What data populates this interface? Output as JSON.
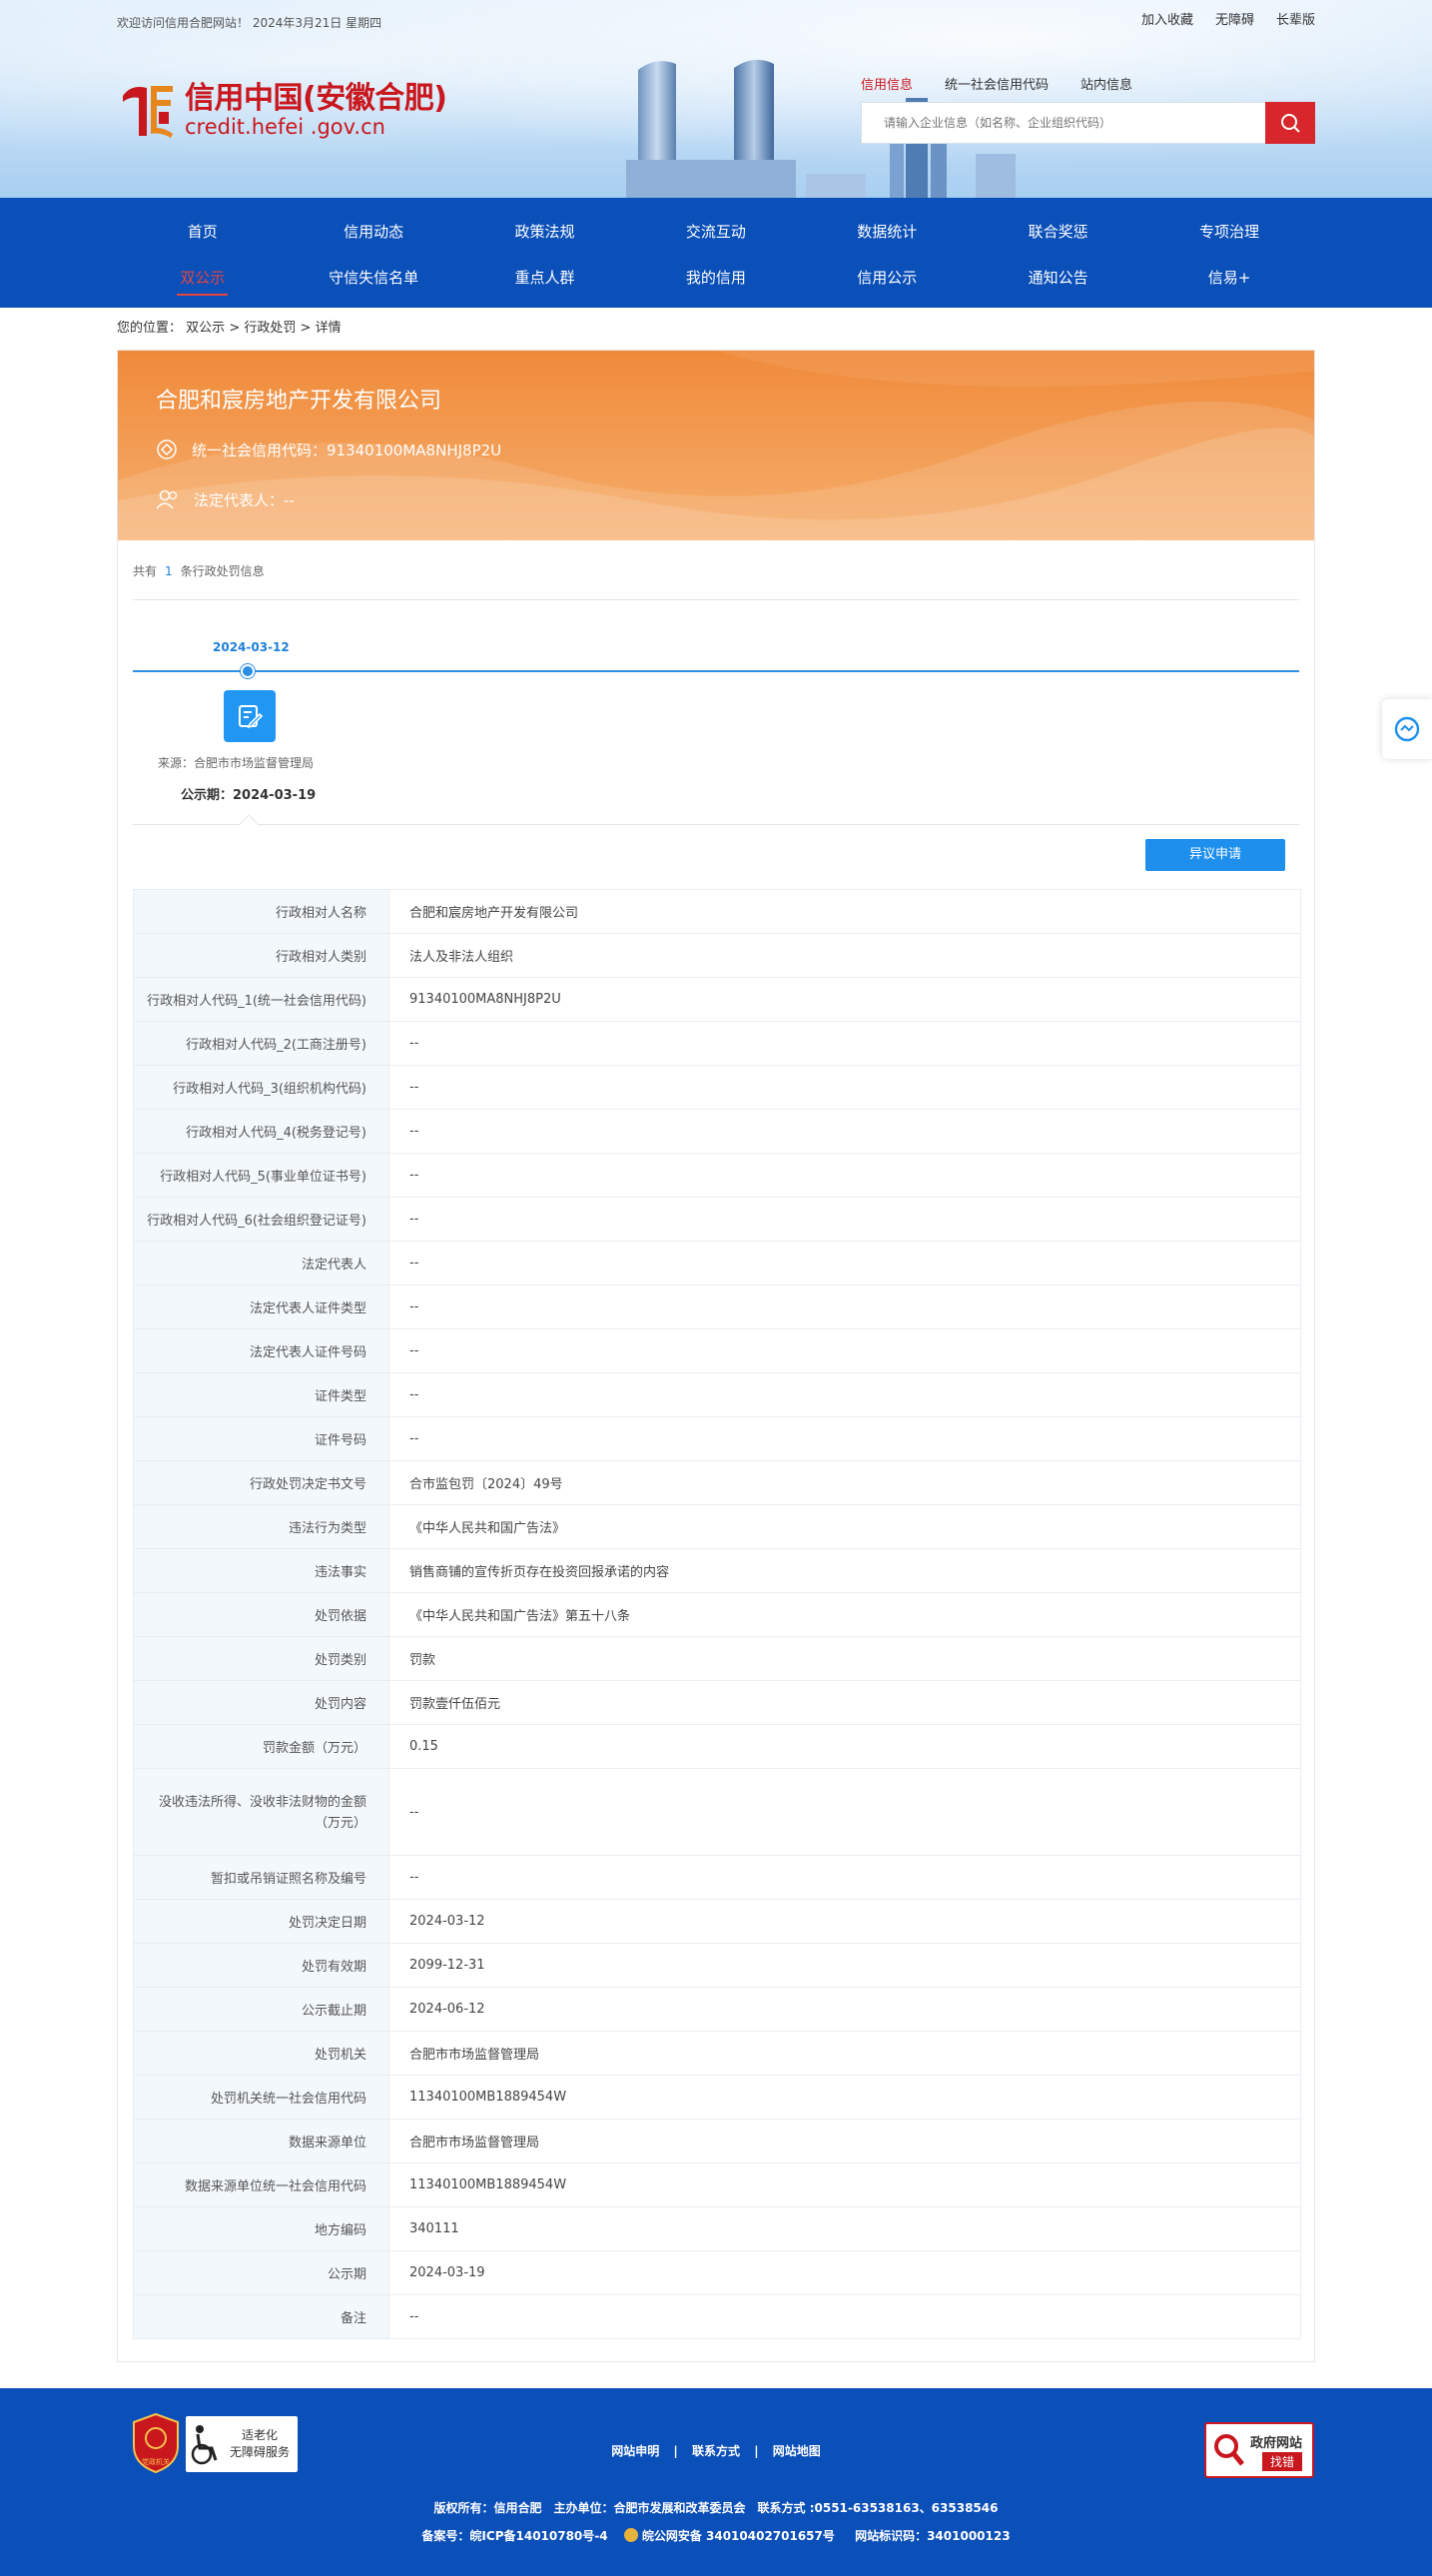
{
  "topbar": {
    "welcome": "欢迎访问信用合肥网站！ 2024年3月21日 星期四",
    "links": [
      "加入收藏",
      "无障碍",
      "长辈版"
    ]
  },
  "logo": {
    "cn": "信用中国(安徽合肥)",
    "en": "credit.hefei .gov.cn"
  },
  "search": {
    "tabs": [
      "信用信息",
      "统一社会信用代码",
      "站内信息"
    ],
    "placeholder": "请输入企业信息（如名称、企业组织代码）"
  },
  "nav": {
    "row1": [
      "首页",
      "信用动态",
      "政策法规",
      "交流互动",
      "数据统计",
      "联合奖惩",
      "专项治理"
    ],
    "row2": [
      "双公示",
      "守信失信名单",
      "重点人群",
      "我的信用",
      "信用公示",
      "通知公告",
      "信易+"
    ]
  },
  "breadcrumb": {
    "label": "您的位置：",
    "items": [
      "双公示",
      "行政处罚",
      "详情"
    ],
    "sep": ">"
  },
  "company": {
    "name": "合肥和宸房地产开发有限公司",
    "credit_code": "统一社会信用代码：91340100MA8NHJ8P2U",
    "legal_rep": "法定代表人：--"
  },
  "count": {
    "prefix": "共有",
    "value": "1",
    "suffix": "条行政处罚信息"
  },
  "timeline": {
    "date": "2024-03-12",
    "source": "来源：合肥市市场监督管理局",
    "public_period": "公示期：2024-03-19"
  },
  "objection_button": "异议申请",
  "details": [
    {
      "k": "行政相对人名称",
      "v": "合肥和宸房地产开发有限公司"
    },
    {
      "k": "行政相对人类别",
      "v": "法人及非法人组织"
    },
    {
      "k": "行政相对人代码_1(统一社会信用代码)",
      "v": "91340100MA8NHJ8P2U"
    },
    {
      "k": "行政相对人代码_2(工商注册号)",
      "v": "--"
    },
    {
      "k": "行政相对人代码_3(组织机构代码)",
      "v": "--"
    },
    {
      "k": "行政相对人代码_4(税务登记号)",
      "v": "--"
    },
    {
      "k": "行政相对人代码_5(事业单位证书号)",
      "v": "--"
    },
    {
      "k": "行政相对人代码_6(社会组织登记证号)",
      "v": "--"
    },
    {
      "k": "法定代表人",
      "v": "--"
    },
    {
      "k": "法定代表人证件类型",
      "v": "--"
    },
    {
      "k": "法定代表人证件号码",
      "v": "--"
    },
    {
      "k": "证件类型",
      "v": "--"
    },
    {
      "k": "证件号码",
      "v": "--"
    },
    {
      "k": "行政处罚决定书文号",
      "v": "合市监包罚〔2024〕49号"
    },
    {
      "k": "违法行为类型",
      "v": "《中华人民共和国广告法》"
    },
    {
      "k": "违法事实",
      "v": "销售商铺的宣传折页存在投资回报承诺的内容"
    },
    {
      "k": "处罚依据",
      "v": "《中华人民共和国广告法》第五十八条"
    },
    {
      "k": "处罚类别",
      "v": "罚款"
    },
    {
      "k": "处罚内容",
      "v": "罚款壹仟伍佰元"
    },
    {
      "k": "罚款金额（万元）",
      "v": "0.15"
    },
    {
      "k": "没收违法所得、没收非法财物的金额（万元）",
      "v": "--",
      "tall": true
    },
    {
      "k": "暂扣或吊销证照名称及编号",
      "v": "--"
    },
    {
      "k": "处罚决定日期",
      "v": "2024-03-12"
    },
    {
      "k": "处罚有效期",
      "v": "2099-12-31"
    },
    {
      "k": "公示截止期",
      "v": "2024-06-12"
    },
    {
      "k": "处罚机关",
      "v": "合肥市市场监督管理局"
    },
    {
      "k": "处罚机关统一社会信用代码",
      "v": "11340100MB1889454W"
    },
    {
      "k": "数据来源单位",
      "v": "合肥市市场监督管理局"
    },
    {
      "k": "数据来源单位统一社会信用代码",
      "v": "11340100MB1889454W"
    },
    {
      "k": "地方编码",
      "v": "340111"
    },
    {
      "k": "公示期",
      "v": "2024-03-19"
    },
    {
      "k": "备注",
      "v": "--"
    }
  ],
  "footer": {
    "links": [
      "网站申明",
      "联系方式",
      "网站地图"
    ],
    "link_sep": "|",
    "copyright": "版权所有：信用合肥　主办单位：合肥市发展和改革委员会　联系方式 :0551-63538163、63538546",
    "icp": "备案号：皖ICP备14010780号-4",
    "police": "皖公网安备 34010402701657号",
    "site_code": "网站标识码：3401000123",
    "access_text": "适老化\n无障碍服务",
    "gov_badge_title": "政府网站",
    "gov_badge_action": "找错",
    "left_badge_text": "党政机关"
  },
  "colors": {
    "brand_red": "#c9171e",
    "nav_blue": "#0b4fb8",
    "accent_blue": "#1e8fec",
    "company_orange": "#f08a3a"
  }
}
